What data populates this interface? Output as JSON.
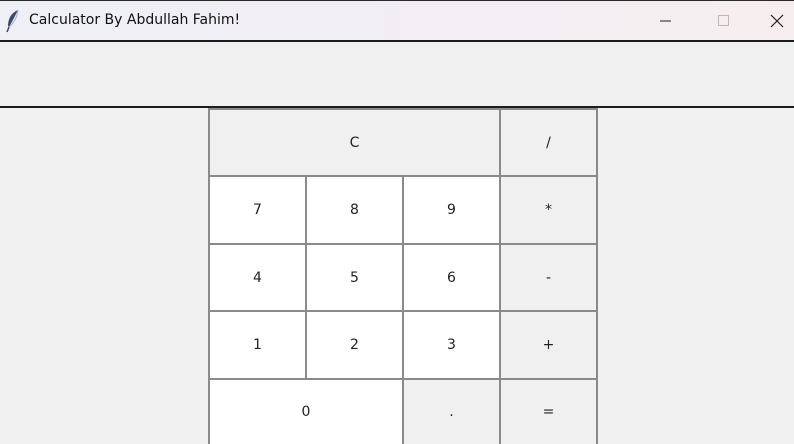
{
  "window": {
    "title": "Calculator By Abdullah Fahim!",
    "minimize_icon": "minimize-icon",
    "maximize_icon": "maximize-icon",
    "close_icon": "close-icon",
    "app_icon": "feather-icon"
  },
  "display": {
    "value": ""
  },
  "keys": {
    "clear": "C",
    "divide": "/",
    "seven": "7",
    "eight": "8",
    "nine": "9",
    "multiply": "*",
    "four": "4",
    "five": "5",
    "six": "6",
    "subtract": "-",
    "one": "1",
    "two": "2",
    "three": "3",
    "add": "+",
    "zero": "0",
    "decimal": ".",
    "equals": "="
  }
}
